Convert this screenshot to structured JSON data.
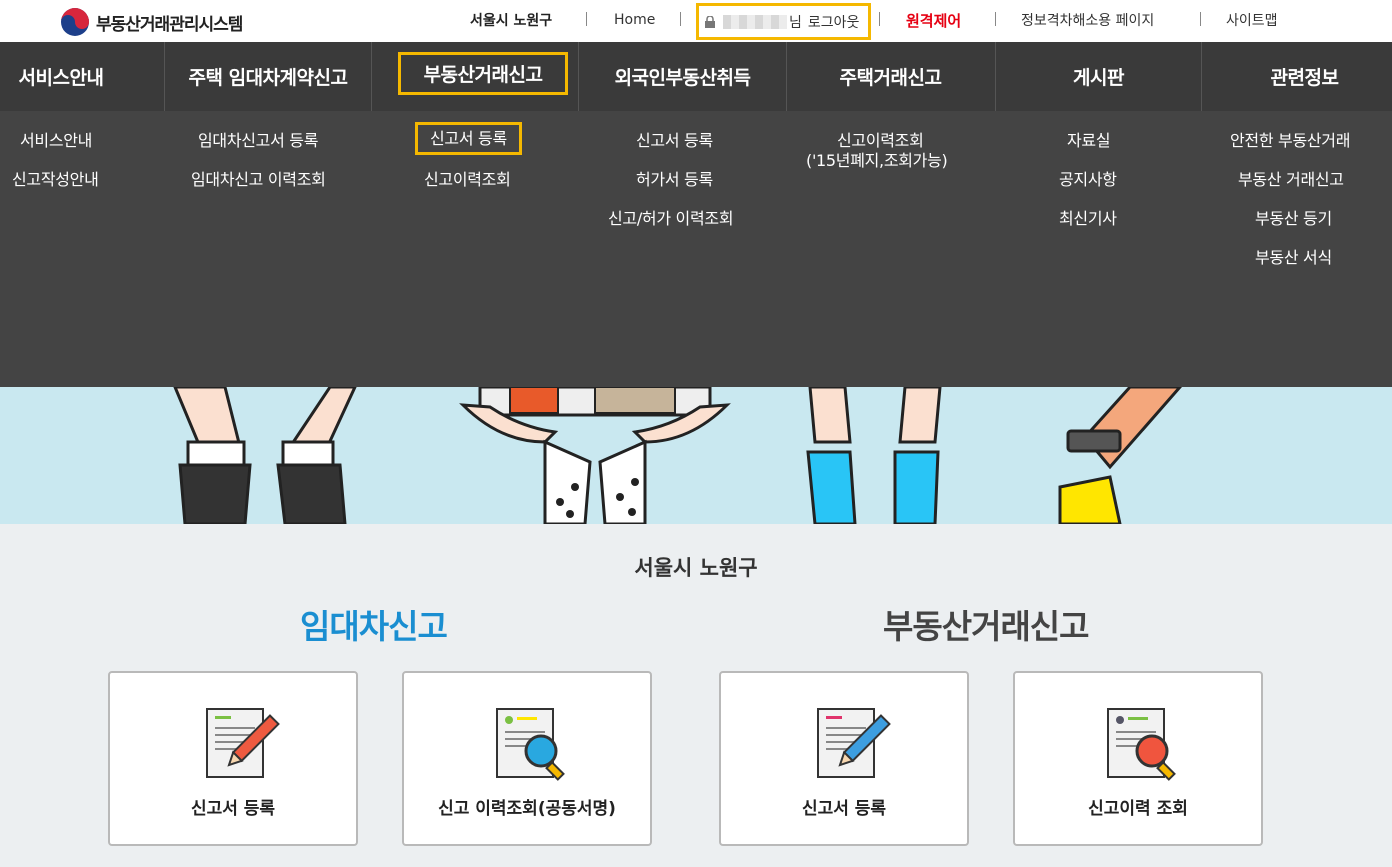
{
  "brand": {
    "name": "부동산거래관리시스템"
  },
  "util": {
    "district": "서울시 노원구",
    "home": "Home",
    "user_suffix": "님",
    "logout": "로그아웃",
    "remote": "원격제어",
    "accessibility": "정보격차해소용 페이지",
    "sitemap": "사이트맵",
    "remote_color": "#e60012"
  },
  "nav": {
    "items": [
      {
        "label": "서비스안내"
      },
      {
        "label": "주택 임대차계약신고"
      },
      {
        "label": "부동산거래신고"
      },
      {
        "label": "외국인부동산취득"
      },
      {
        "label": "주택거래신고"
      },
      {
        "label": "게시판"
      },
      {
        "label": "관련정보"
      }
    ],
    "highlight_color": "#f5b800"
  },
  "dropdown": {
    "col0": [
      "서비스안내",
      "신고작성안내"
    ],
    "col1": [
      "임대차신고서 등록",
      "임대차신고 이력조회"
    ],
    "col2": [
      "신고서 등록",
      "신고이력조회"
    ],
    "col3": [
      "신고서 등록",
      "허가서 등록",
      "신고/허가 이력조회"
    ],
    "col4": [
      "신고이력조회",
      "('15년폐지,조회가능)"
    ],
    "col5": [
      "자료실",
      "공지사항",
      "최신기사"
    ],
    "col6": [
      "안전한 부동산거래",
      "부동산 거래신고",
      "부동산 등기",
      "부동산 서식"
    ]
  },
  "main": {
    "region": "서울시 노원구",
    "lease": {
      "title": "임대차신고",
      "title_color": "#1a8ed1",
      "cards": [
        {
          "label": "신고서 등록",
          "icon": "pencil-doc-icon"
        },
        {
          "label": "신고 이력조회(공동서명)",
          "icon": "search-doc-icon"
        }
      ]
    },
    "trade": {
      "title": "부동산거래신고",
      "title_color": "#444444",
      "cards": [
        {
          "label": "신고서 등록",
          "icon": "pencil-doc-icon"
        },
        {
          "label": "신고이력 조회",
          "icon": "search-doc-icon"
        }
      ]
    }
  }
}
